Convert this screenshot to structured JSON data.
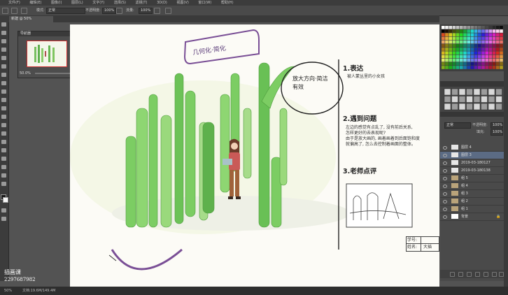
{
  "menubar": {
    "items": [
      "文件(F)",
      "编辑(E)",
      "图像(I)",
      "图层(L)",
      "文字(Y)",
      "选择(S)",
      "滤镜(T)",
      "3D(D)",
      "视图(V)",
      "窗口(W)",
      "帮助(H)"
    ]
  },
  "options": {
    "mode_label": "模式:",
    "mode_value": "正常",
    "opacity_label": "不透明度:",
    "opacity_value": "100%",
    "flow_label": "流量:",
    "flow_value": "100%"
  },
  "document": {
    "tab_label": "新建 @ 50%"
  },
  "navigator": {
    "title": "导航器",
    "zoom": "50.0%"
  },
  "canvas": {
    "title_handwritten": "几何化·简化",
    "bubble_note": "放大方向·简洁有效",
    "section1": {
      "heading": "1.表达",
      "text": "被人蒙丛里的小女孩"
    },
    "section2": {
      "heading": "2.遇到问题",
      "lines": [
        "左边的感觉有点乱了, 没有前后关系,",
        "怎样更好的去表现呢?",
        "由于是放大画的, 画着画着到后面饱和度",
        "就偏高了, 怎么去控制着画面的整体。"
      ]
    },
    "section3": {
      "heading": "3.老师点评"
    },
    "student": {
      "id_label": "学号:",
      "id_value": "",
      "name_label": "姓名:",
      "name_value": "大插"
    }
  },
  "layers_panel": {
    "blend_mode": "正常",
    "opacity_label": "不透明度:",
    "opacity_value": "100%",
    "fill_label": "填充:",
    "fill_value": "100%",
    "layers": [
      {
        "name": "图层 4"
      },
      {
        "name": "图层 3"
      },
      {
        "name": "2019-03-180127"
      },
      {
        "name": "2019-03-180138"
      },
      {
        "name": "组 5"
      },
      {
        "name": "组 4"
      },
      {
        "name": "组 3"
      },
      {
        "name": "组 2"
      },
      {
        "name": "组 1"
      },
      {
        "name": "背景"
      }
    ]
  },
  "watermark": {
    "line1": "插画课",
    "line2": "2297687982"
  },
  "status": {
    "zoom": "50%",
    "doc": "文档:19.6M/149.4M"
  },
  "colors": {
    "accent_pen": "#7a4f96",
    "cactus": "#6fbf5a"
  }
}
